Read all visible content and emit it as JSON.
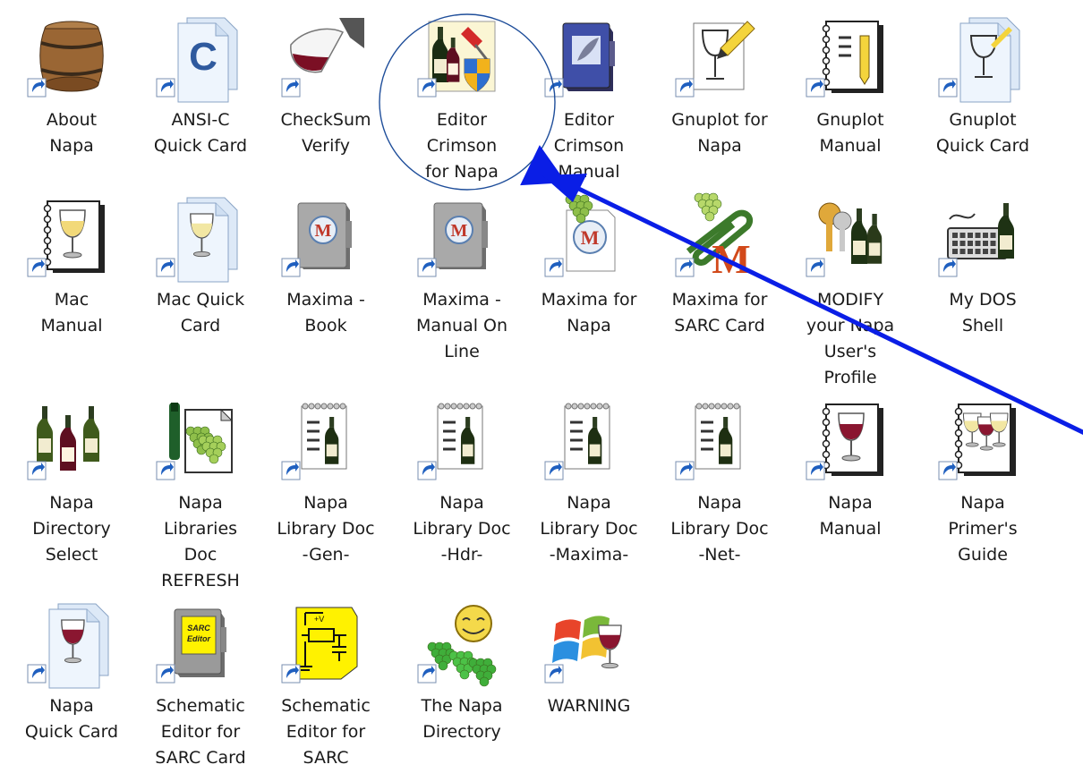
{
  "desktop": {
    "icons": [
      {
        "label": "About\nNapa",
        "icon": "wine-barrel-icon"
      },
      {
        "label": "ANSI-C\nQuick Card",
        "icon": "c-document-icon"
      },
      {
        "label": "CheckSum\nVerify",
        "icon": "wine-glass-pour-icon"
      },
      {
        "label": "Editor\nCrimson\nfor Napa",
        "icon": "wine-editor-shield-icon"
      },
      {
        "label": "Editor\nCrimson\nManual",
        "icon": "feather-book-icon"
      },
      {
        "label": "Gnuplot for\nNapa",
        "icon": "glass-pencil-icon"
      },
      {
        "label": "Gnuplot\nManual",
        "icon": "notebook-pencil-icon"
      },
      {
        "label": "Gnuplot\nQuick Card",
        "icon": "glass-document-icon"
      },
      {
        "label": "Mac\nManual",
        "icon": "white-wine-notebook-icon"
      },
      {
        "label": "Mac Quick\nCard",
        "icon": "white-wine-document-icon"
      },
      {
        "label": "Maxima -\nBook",
        "icon": "maxima-book-icon"
      },
      {
        "label": "Maxima -\nManual On\nLine",
        "icon": "maxima-book-icon"
      },
      {
        "label": "Maxima for\nNapa",
        "icon": "maxima-grapes-icon"
      },
      {
        "label": "Maxima for\nSARC Card",
        "icon": "maxima-clip-icon"
      },
      {
        "label": "MODIFY\nyour Napa\nUser's\nProfile",
        "icon": "keys-bottles-icon"
      },
      {
        "label": "My DOS\nShell",
        "icon": "keyboard-bottle-icon"
      },
      {
        "label": "Napa\nDirectory\nSelect",
        "icon": "three-bottles-icon"
      },
      {
        "label": "Napa\nLibraries\nDoc\nREFRESH",
        "icon": "grapes-document-icon"
      },
      {
        "label": "Napa\nLibrary Doc\n-Gen-",
        "icon": "notepad-bottle-icon"
      },
      {
        "label": "Napa\nLibrary Doc\n-Hdr-",
        "icon": "notepad-bottle-icon"
      },
      {
        "label": "Napa\nLibrary Doc\n-Maxima-",
        "icon": "notepad-bottle-icon"
      },
      {
        "label": "Napa\nLibrary Doc\n-Net-",
        "icon": "notepad-bottle-icon"
      },
      {
        "label": "Napa\nManual",
        "icon": "red-wine-notebook-icon"
      },
      {
        "label": "Napa\nPrimer's\nGuide",
        "icon": "glasses-notebook-icon"
      },
      {
        "label": "Napa\nQuick Card",
        "icon": "red-wine-document-icon"
      },
      {
        "label": "Schematic\nEditor for\nSARC Card",
        "icon": "sarc-editor-book-icon"
      },
      {
        "label": "Schematic\nEditor for\nSARC",
        "icon": "schematic-icon"
      },
      {
        "label": "The Napa\nDirectory",
        "icon": "smiley-grapes-icon"
      },
      {
        "label": "WARNING",
        "icon": "windows-wine-icon"
      }
    ],
    "annotation": {
      "circle_color": "#1f4e9a",
      "arrow_color": "#0a1ee6"
    }
  }
}
